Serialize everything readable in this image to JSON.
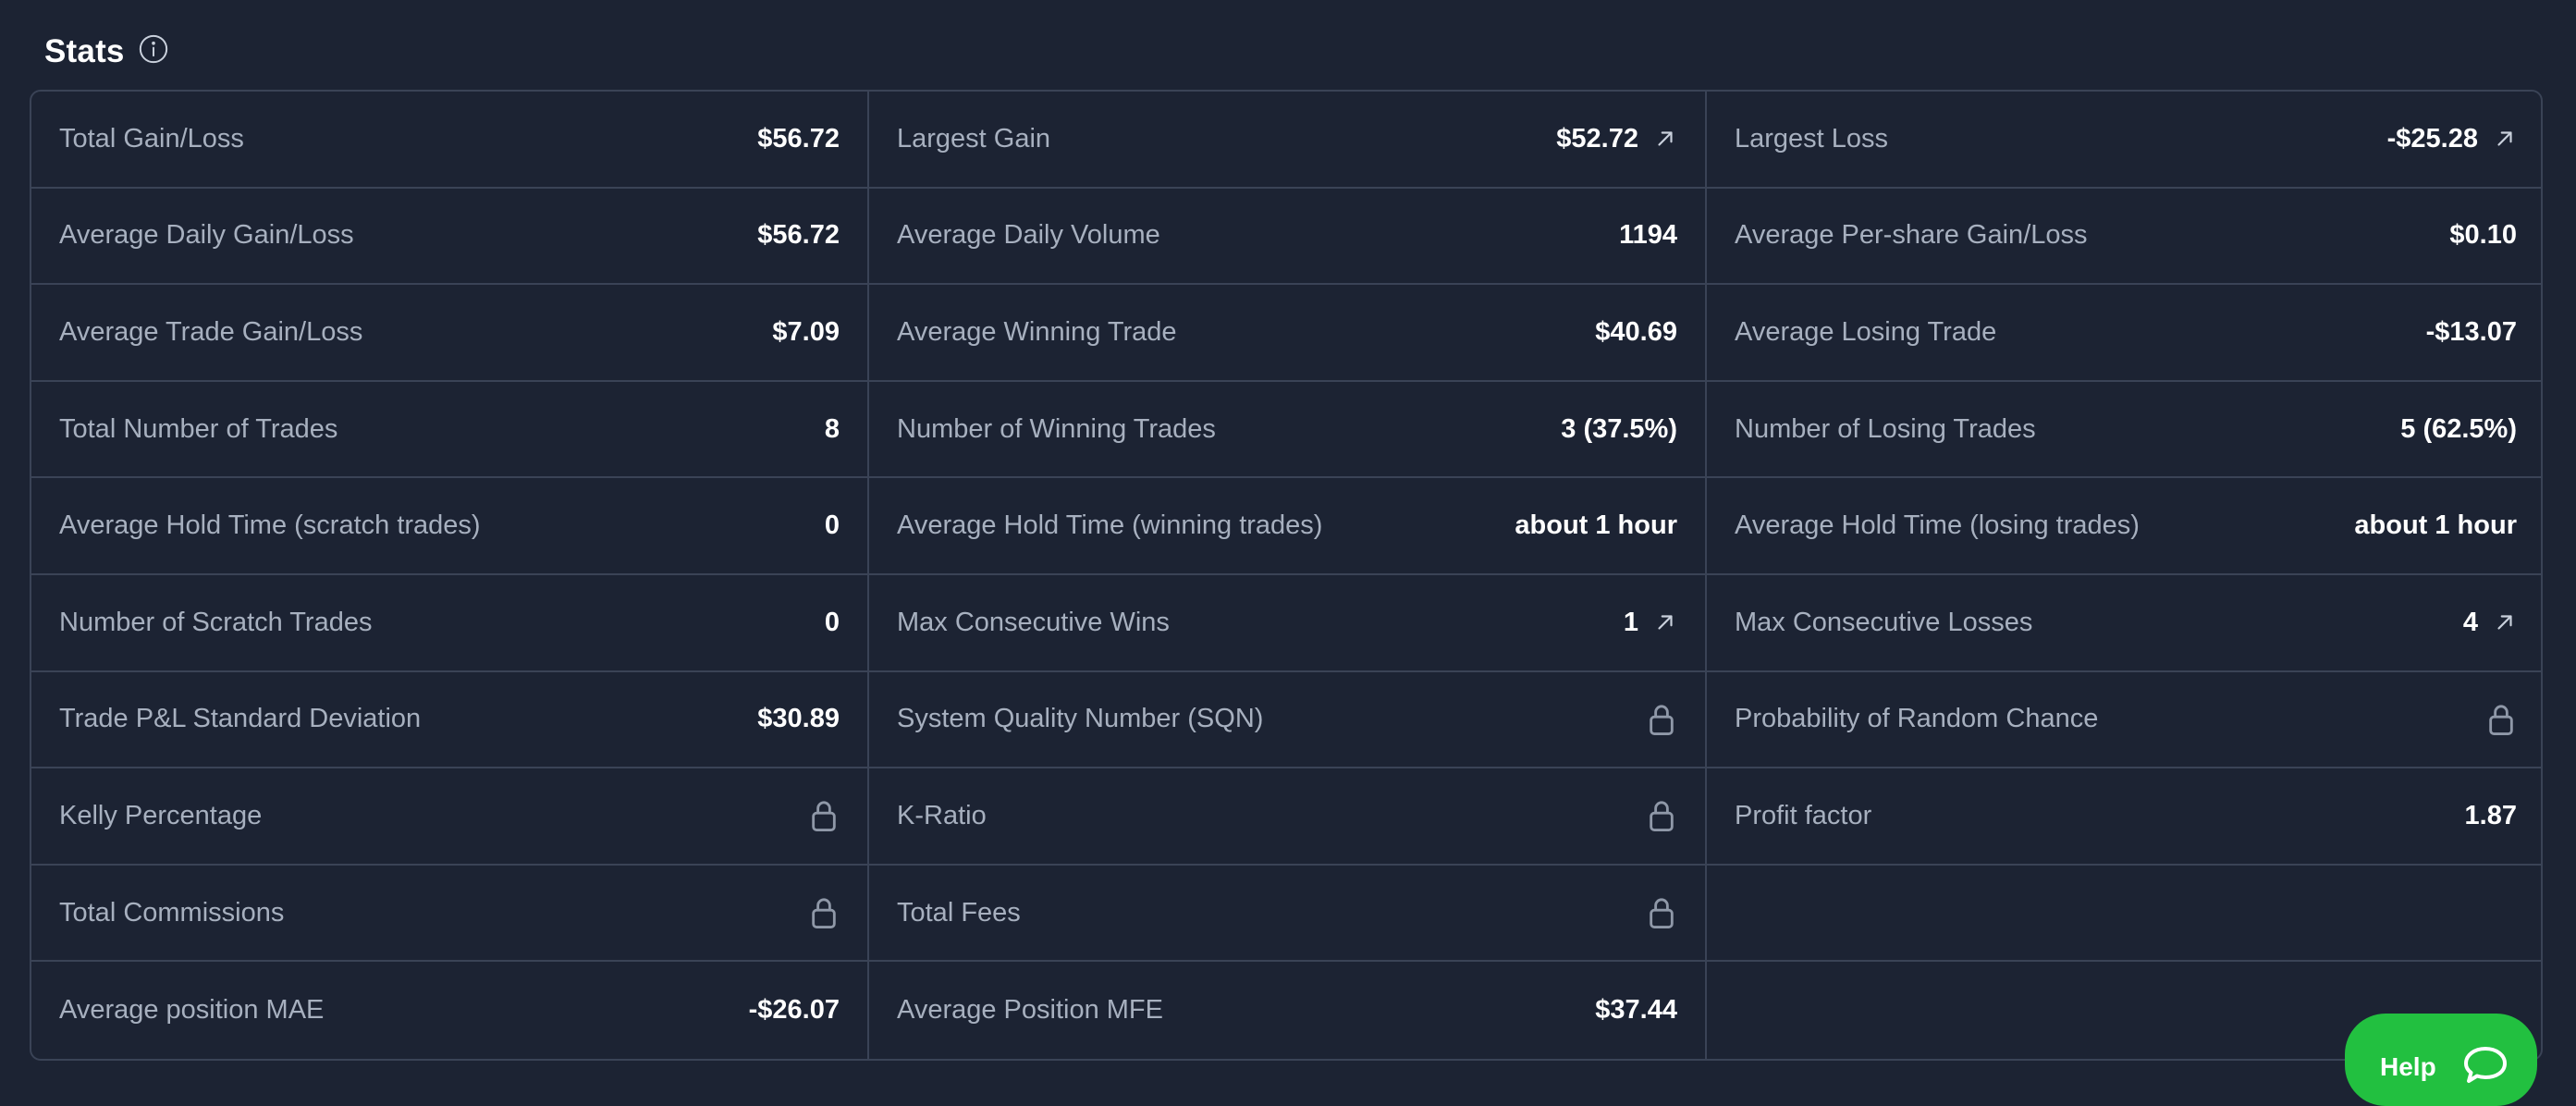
{
  "header": {
    "title": "Stats",
    "icon": "info-icon"
  },
  "colors": {
    "background": "#1c2333",
    "border": "#3a4356",
    "label": "#a7b0bf",
    "value": "#ffffff",
    "help_button": "#22c040"
  },
  "stats": {
    "rows": [
      [
        {
          "label": "Total Gain/Loss",
          "value": "$56.72"
        },
        {
          "label": "Largest Gain",
          "value": "$52.72",
          "icon": "external-arrow-icon"
        },
        {
          "label": "Largest Loss",
          "value": "-$25.28",
          "icon": "external-arrow-icon"
        }
      ],
      [
        {
          "label": "Average Daily Gain/Loss",
          "value": "$56.72"
        },
        {
          "label": "Average Daily Volume",
          "value": "1194"
        },
        {
          "label": "Average Per-share Gain/Loss",
          "value": "$0.10"
        }
      ],
      [
        {
          "label": "Average Trade Gain/Loss",
          "value": "$7.09"
        },
        {
          "label": "Average Winning Trade",
          "value": "$40.69"
        },
        {
          "label": "Average Losing Trade",
          "value": "-$13.07"
        }
      ],
      [
        {
          "label": "Total Number of Trades",
          "value": "8"
        },
        {
          "label": "Number of Winning Trades",
          "value": "3 (37.5%)"
        },
        {
          "label": "Number of Losing Trades",
          "value": "5 (62.5%)"
        }
      ],
      [
        {
          "label": "Average Hold Time (scratch trades)",
          "value": "0"
        },
        {
          "label": "Average Hold Time (winning trades)",
          "value": "about 1 hour"
        },
        {
          "label": "Average Hold Time (losing trades)",
          "value": "about 1 hour"
        }
      ],
      [
        {
          "label": "Number of Scratch Trades",
          "value": "0"
        },
        {
          "label": "Max Consecutive Wins",
          "value": "1",
          "icon": "external-arrow-icon"
        },
        {
          "label": "Max Consecutive Losses",
          "value": "4",
          "icon": "external-arrow-icon"
        }
      ],
      [
        {
          "label": "Trade P&L Standard Deviation",
          "value": "$30.89"
        },
        {
          "label": "System Quality Number (SQN)",
          "icon": "lock-icon"
        },
        {
          "label": "Probability of Random Chance",
          "icon": "lock-icon"
        }
      ],
      [
        {
          "label": "Kelly Percentage",
          "icon": "lock-icon"
        },
        {
          "label": "K-Ratio",
          "icon": "lock-icon"
        },
        {
          "label": "Profit factor",
          "value": "1.87"
        }
      ],
      [
        {
          "label": "Total Commissions",
          "icon": "lock-icon"
        },
        {
          "label": "Total Fees",
          "icon": "lock-icon"
        },
        {}
      ],
      [
        {
          "label": "Average position MAE",
          "value": "-$26.07"
        },
        {
          "label": "Average Position MFE",
          "value": "$37.44"
        },
        {}
      ]
    ]
  },
  "help": {
    "label": "Help",
    "icon": "chat-bubble-icon"
  }
}
